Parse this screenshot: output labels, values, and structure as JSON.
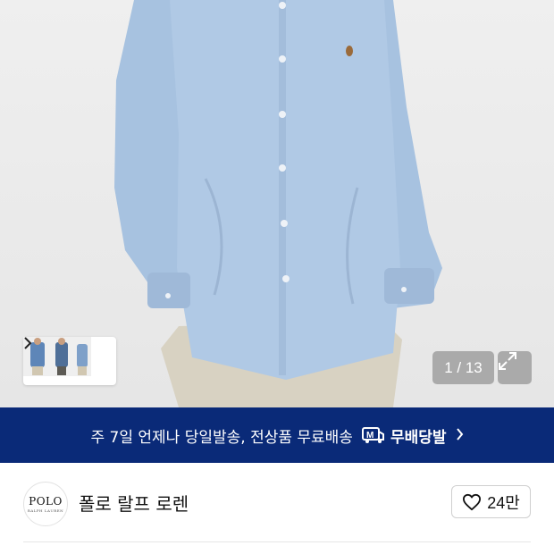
{
  "gallery": {
    "counter": "1 / 13",
    "thumbnail_count": 3
  },
  "banner": {
    "text": "주 7일 언제나 당일발송, 전상품 무료배송",
    "badge_label": "무배당발",
    "badge_icon": "truck-m-icon",
    "chevron_icon": "chevron-right-icon"
  },
  "brand": {
    "name": "폴로 랄프 로렌",
    "logo_line1": "POLO",
    "logo_line2": "RALPH LAUREN"
  },
  "like": {
    "count": "24만",
    "icon": "heart-outline-icon"
  },
  "colors": {
    "banner_bg": "#0a2a78",
    "shirt": "#a9c4e2",
    "background": "#ececec"
  }
}
